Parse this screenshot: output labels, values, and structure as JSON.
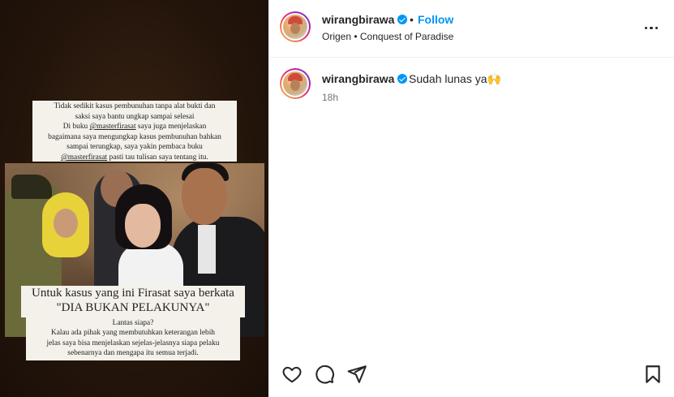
{
  "media": {
    "caption_top": {
      "line1": "Tidak sedikit kasus pembunuhan tanpa alat bukti dan",
      "line2": "saksi saya bantu ungkap sampai selesai",
      "line3_pre": "Di buku ",
      "line3_mention": "@masterfirasat",
      "line3_post": " saya juga menjelaskan",
      "line4": "bagaimana saya mengungkap kasus pembunuhan bahkan",
      "line5": "sampai terungkap, saya yakin pembaca buku",
      "line6_mention": "@masterfirasat",
      "line6_post": "  pasti tau tulisan saya tentang itu."
    },
    "caption_mid": {
      "line1": "Untuk kasus yang ini Firasat saya berkata",
      "line2": "\"DIA BUKAN PELAKUNYA\""
    },
    "caption_bottom": {
      "line1": "Lantas siapa?",
      "line2": "Kalau ada pihak yang membutuhkan keterangan lebih",
      "line3": "jelas saya bisa menjelaskan sejelas-jelasnya siapa pelaku",
      "line4": "sebenarnya dan mengapa itu semua terjadi."
    }
  },
  "header": {
    "username": "wirangbirawa",
    "separator": "•",
    "follow_label": "Follow",
    "subtitle": "Origen • Conquest of Paradise",
    "more_icon": "more-horizontal-icon"
  },
  "comment": {
    "username": "wirangbirawa",
    "text": "Sudah lunas ya🙌",
    "time": "18h"
  },
  "actions": {
    "like_icon": "heart-icon",
    "comment_icon": "comment-icon",
    "share_icon": "share-icon",
    "save_icon": "bookmark-icon"
  },
  "colors": {
    "accent": "#0095f6",
    "text": "#262626",
    "muted": "#737373"
  }
}
